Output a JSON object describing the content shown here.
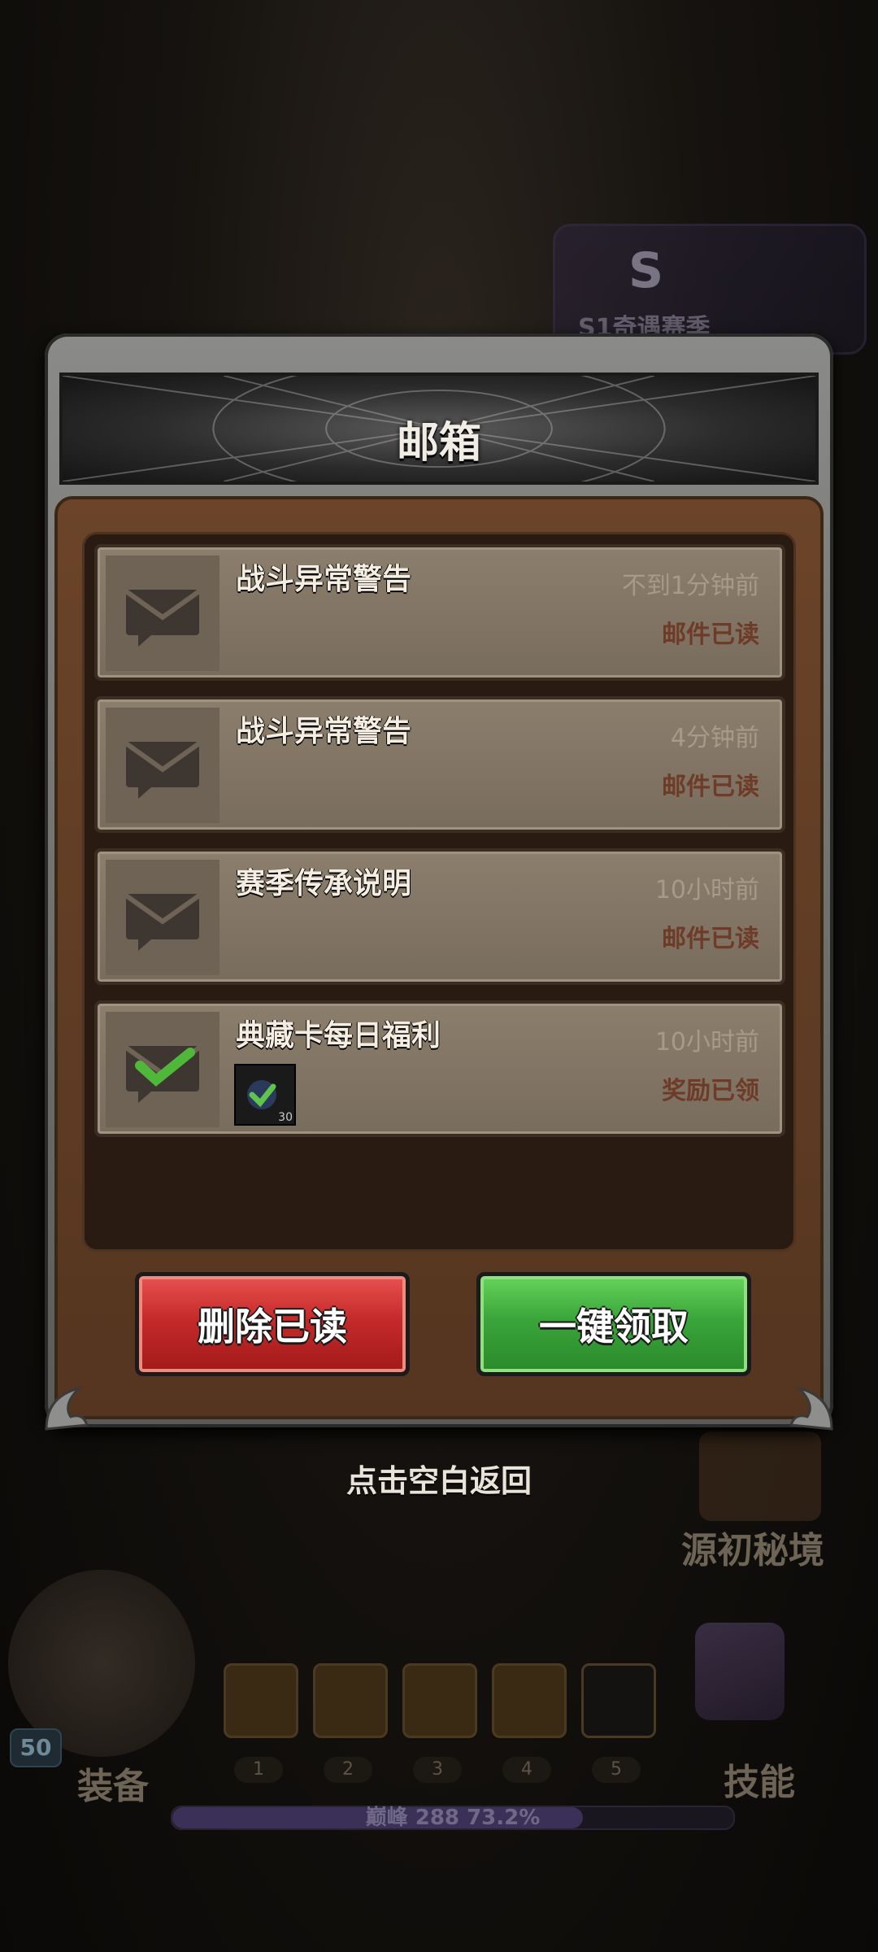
{
  "dialog": {
    "title": "邮箱",
    "mails": [
      {
        "title": "战斗异常警告",
        "time": "不到1分钟前",
        "status": "邮件已读",
        "icon": "envelope-icon"
      },
      {
        "title": "战斗异常警告",
        "time": "4分钟前",
        "status": "邮件已读",
        "icon": "envelope-icon"
      },
      {
        "title": "赛季传承说明",
        "time": "10小时前",
        "status": "邮件已读",
        "icon": "envelope-icon"
      },
      {
        "title": "典藏卡每日福利",
        "time": "10小时前",
        "status": "奖励已领",
        "icon": "envelope-checked-icon",
        "reward_count": "30"
      }
    ],
    "delete_read_label": "删除已读",
    "claim_all_label": "一键领取",
    "hint": "点击空白返回"
  },
  "background": {
    "season_label": "S1奇遇赛季",
    "season_letter": "S",
    "boss_label": "源初秘境",
    "equip_label": "装备",
    "skill_label": "技能",
    "level": "50",
    "slot_numbers": [
      "1",
      "2",
      "3",
      "4",
      "5"
    ],
    "progress_text": "巅峰 288  73.2%",
    "progress_fraction": 0.732
  },
  "colors": {
    "delete_button": "#c52a2a",
    "claim_button": "#3aa53a",
    "panel_brown": "#6b4429"
  }
}
